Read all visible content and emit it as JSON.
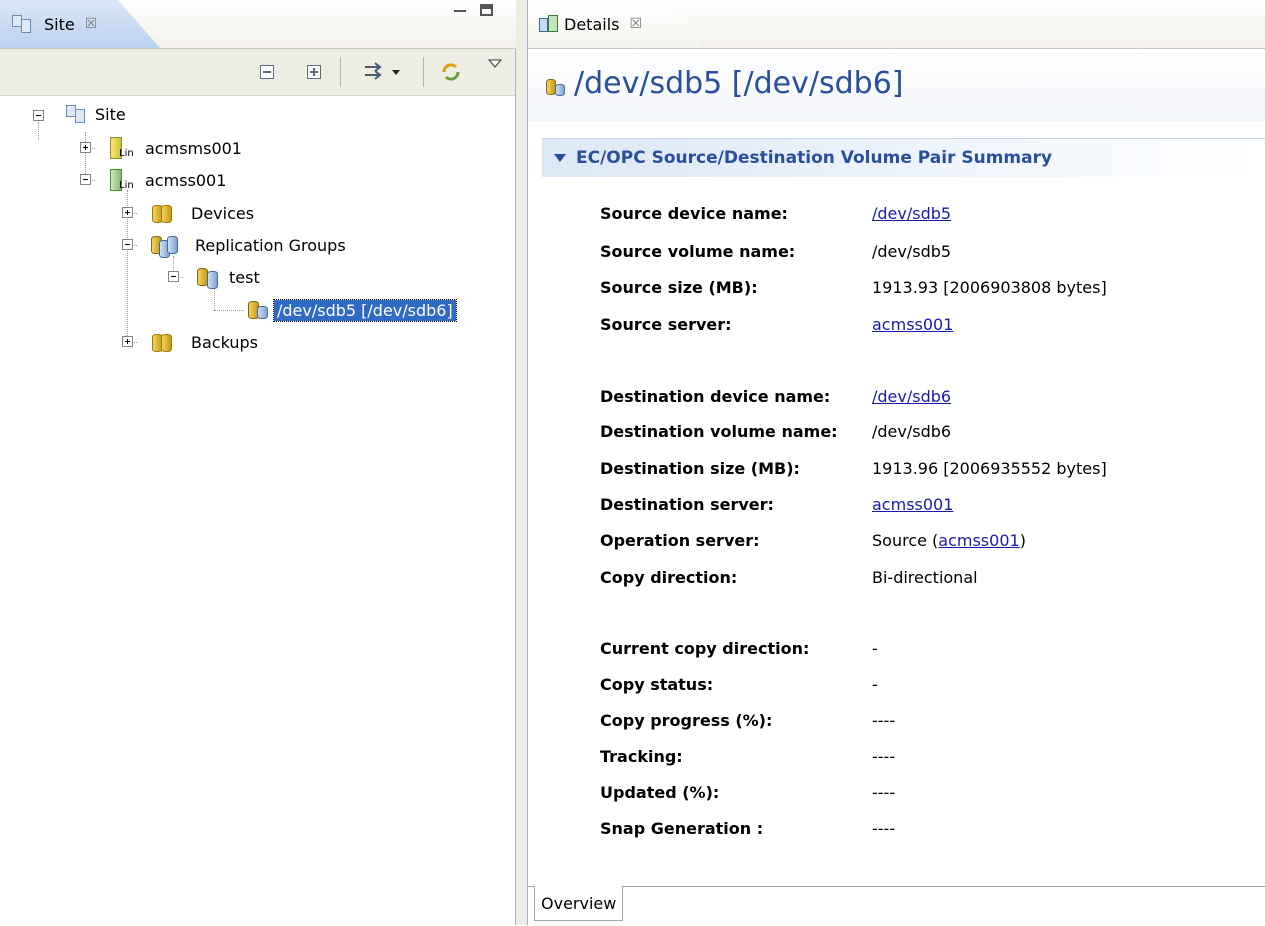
{
  "left_view": {
    "tab_label": "Site",
    "close_symbol": "☒",
    "tree": {
      "root": "Site",
      "servers": [
        {
          "name": "acmsms001",
          "os_badge": "Lin",
          "expanded": false
        },
        {
          "name": "acmss001",
          "os_badge": "Lin",
          "expanded": true
        }
      ],
      "devices_label": "Devices",
      "replication_groups_label": "Replication Groups",
      "group_name": "test",
      "selected_pair": "/dev/sdb5 [/dev/sdb6]",
      "backups_label": "Backups"
    }
  },
  "right_view": {
    "tab_label": "Details",
    "close_symbol": "☒",
    "title": "/dev/sdb5 [/dev/sdb6]",
    "section_title": "EC/OPC Source/Destination Volume Pair Summary",
    "properties": {
      "source_device_label": "Source device name:",
      "source_device_value": "/dev/sdb5",
      "source_volume_label": "Source volume name:",
      "source_volume_value": "/dev/sdb5",
      "source_size_label": "Source size (MB):",
      "source_size_value": "1913.93 [2006903808 bytes]",
      "source_server_label": "Source server:",
      "source_server_value": "acmss001",
      "dest_device_label": "Destination device name:",
      "dest_device_value": "/dev/sdb6",
      "dest_volume_label": "Destination volume name:",
      "dest_volume_value": "/dev/sdb6",
      "dest_size_label": "Destination size (MB):",
      "dest_size_value": "1913.96 [2006935552 bytes]",
      "dest_server_label": "Destination server:",
      "dest_server_value": "acmss001",
      "operation_server_label": "Operation server:",
      "operation_server_prefix": "Source (",
      "operation_server_link": "acmss001",
      "operation_server_suffix": ")",
      "copy_direction_label": "Copy direction:",
      "copy_direction_value": "Bi-directional",
      "current_copy_direction_label": "Current copy direction:",
      "current_copy_direction_value": "-",
      "copy_status_label": "Copy status:",
      "copy_status_value": "-",
      "copy_progress_label": "Copy progress (%):",
      "copy_progress_value": "----",
      "tracking_label": "Tracking:",
      "tracking_value": "----",
      "updated_label": "Updated (%):",
      "updated_value": "----",
      "snap_generation_label": "Snap Generation :",
      "snap_generation_value": "----"
    },
    "bottom_tab": "Overview"
  },
  "colors": {
    "selection": "#316ac5",
    "title_blue": "#2a4f9a",
    "link": "#1a1aa8"
  }
}
